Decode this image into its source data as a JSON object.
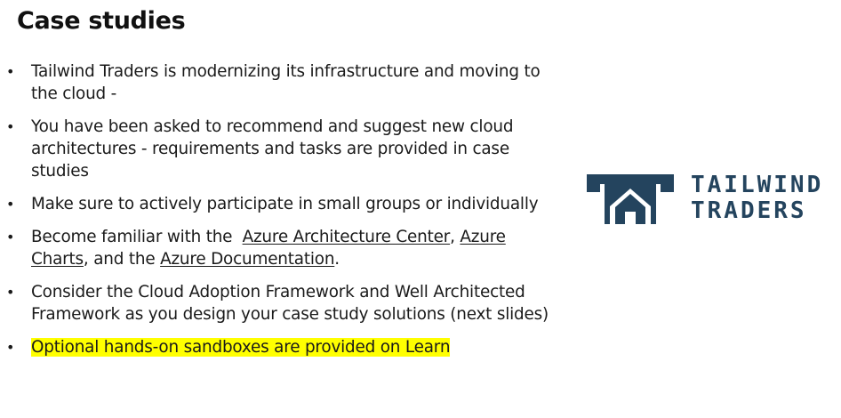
{
  "title": "Case studies",
  "bullets": [
    {
      "text": "Tailwind Traders is modernizing its infrastructure and moving to the cloud -"
    },
    {
      "text": "You have been asked to recommend and suggest new cloud architectures - requirements and tasks are provided in case studies"
    },
    {
      "text": "Make sure to actively participate in small groups or individually"
    },
    {
      "prefix": "Become familiar with the  ",
      "link1": "Azure Architecture Center",
      "sep1": ", ",
      "link2": "Azure Charts",
      "sep2": ", and the ",
      "link3": "Azure Documentation",
      "suffix": "."
    },
    {
      "text": "Consider the Cloud Adoption Framework and Well Architected Framework as you design your case study solutions (next slides)"
    },
    {
      "text": "Optional hands-on sandboxes are provided on Learn",
      "highlight_color": "#ffff00"
    }
  ],
  "bullet_glyph": "•",
  "logo": {
    "line1": "TAILWIND",
    "line2": "TRADERS",
    "color": "#24445e",
    "icon": "house-icon"
  }
}
